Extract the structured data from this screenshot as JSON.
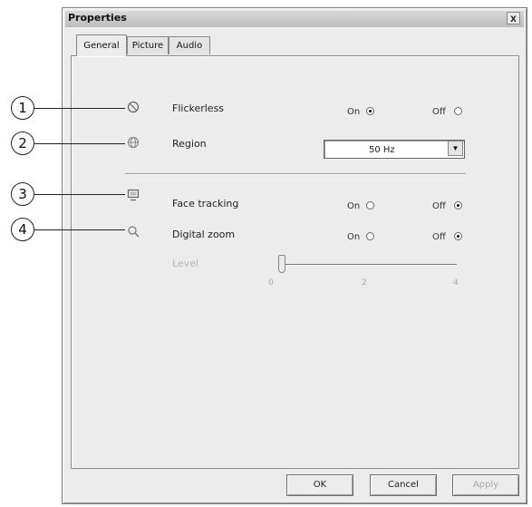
{
  "window": {
    "title": "Properties",
    "close_label": "x"
  },
  "tabs": [
    {
      "label": "General",
      "active": true
    },
    {
      "label": "Picture",
      "active": false
    },
    {
      "label": "Audio",
      "active": false
    }
  ],
  "callouts": [
    "1",
    "2",
    "3",
    "4"
  ],
  "settings": {
    "flickerless": {
      "label": "Flickerless",
      "on_label": "On",
      "off_label": "Off",
      "selected": "On",
      "icon": "flicker-icon"
    },
    "region": {
      "label": "Region",
      "value": "50 Hz",
      "icon": "globe-icon"
    },
    "face_tracking": {
      "label": "Face tracking",
      "on_label": "On",
      "off_label": "Off",
      "selected": "Off",
      "icon": "monitor-icon"
    },
    "digital_zoom": {
      "label": "Digital zoom",
      "on_label": "On",
      "off_label": "Off",
      "selected": "Off",
      "icon": "magnifier-icon"
    },
    "level": {
      "label": "Level",
      "value": 0,
      "ticks": [
        "0",
        "2",
        "4"
      ],
      "enabled": false
    }
  },
  "buttons": {
    "ok": "OK",
    "cancel": "Cancel",
    "apply": "Apply"
  },
  "colors": {
    "window_bg": "#ececec",
    "border": "#7a7a7a"
  }
}
